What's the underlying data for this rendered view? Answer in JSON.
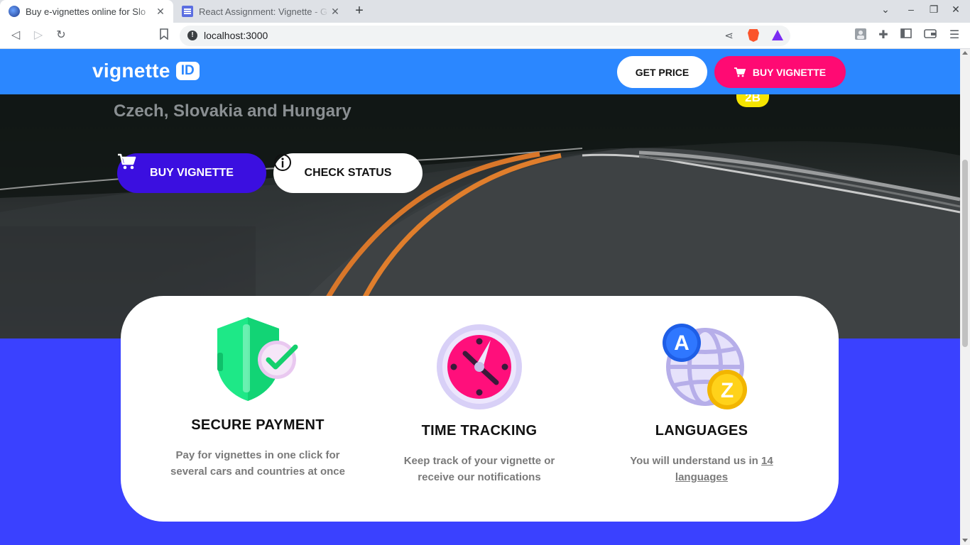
{
  "browser": {
    "tabs": [
      {
        "title": "Buy e-vignettes online for Slo",
        "active": true
      },
      {
        "title": "React Assignment: Vignette - G",
        "active": false
      }
    ],
    "new_tab_label": "+",
    "url": "localhost:3000"
  },
  "header": {
    "logo_text": "vignette",
    "logo_badge": "ID",
    "get_price_label": "GET PRICE",
    "buy_label": "BUY VIGNETTE"
  },
  "hero": {
    "subtitle": "Czech, Slovakia and Hungary",
    "badge": "2B",
    "buy_button_label": "BUY VIGNETTE",
    "check_status_label": "CHECK STATUS"
  },
  "features": [
    {
      "icon": "shield-check-icon",
      "title": "SECURE PAYMENT",
      "text": "Pay for vignettes in one click for several cars and countries at once"
    },
    {
      "icon": "clock-icon",
      "title": "TIME TRACKING",
      "text": "Keep track of your vignette or receive our notifications"
    },
    {
      "icon": "globe-languages-icon",
      "title": "LANGUAGES",
      "text_before": "You will understand us in ",
      "text_link": "14 languages"
    }
  ],
  "colors": {
    "header": "#2b87ff",
    "buy_accent": "#ff0a73",
    "hero_primary": "#3b0fe0",
    "band": "#3a41ff"
  }
}
